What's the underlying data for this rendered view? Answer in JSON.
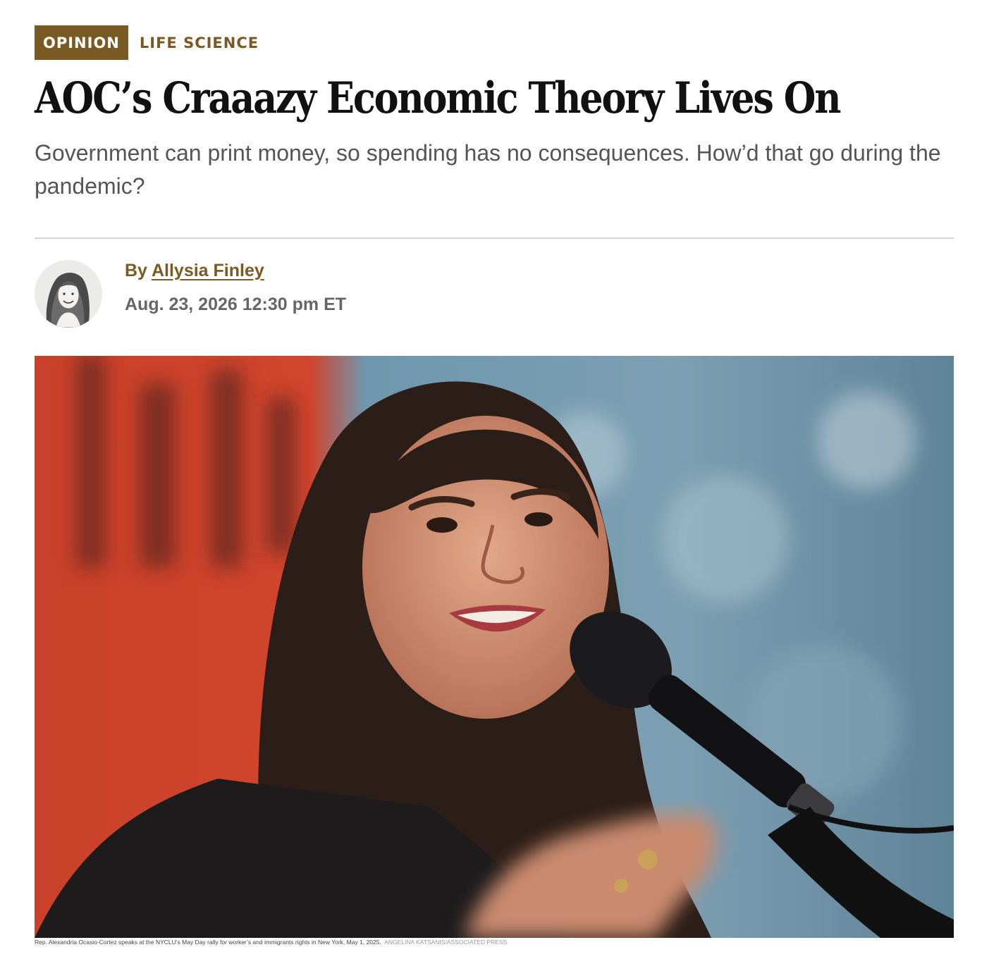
{
  "labels": {
    "opinion": "OPINION",
    "section": "LIFE SCIENCE"
  },
  "headline": "AOC’s Craaazy Economic Theory Lives On",
  "dek": "Government can print money, so spending has no consequences. How’d that go during the pandemic?",
  "byline": {
    "prefix": "By",
    "author": "Allysia Finley",
    "timestamp": "Aug. 23, 2026 12:30 pm ET"
  },
  "image": {
    "caption": "Rep. Alexandria Ocasio-Cortez speaks at the NYCLU’s May Day rally for worker’s and immigrants rights in New York, May 1, 2025.",
    "credit": "Angelina Katsanis/Associated Press"
  },
  "colors": {
    "accent": "#7a5a23",
    "dek_text": "#555555",
    "divider": "#d6d6d6"
  }
}
